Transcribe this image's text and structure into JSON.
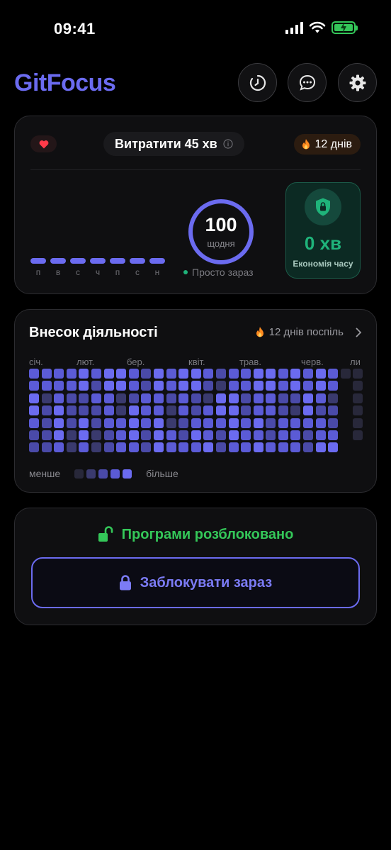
{
  "status_bar": {
    "time": "09:41"
  },
  "app": {
    "title": "GitFocus"
  },
  "summary": {
    "spend_label": "Витратити 45 хв",
    "streak_label": "12 днів",
    "weekdays": [
      "п",
      "в",
      "с",
      "ч",
      "п",
      "с",
      "н"
    ],
    "score": "100",
    "score_caption": "щодня",
    "status_now": "Просто зараз",
    "saving_value": "0 хв",
    "saving_caption": "Економія часу"
  },
  "activity": {
    "title": "Внесок діяльності",
    "streak_label": "12 днів поспіль",
    "months": [
      "січ.",
      "лют.",
      "бер.",
      "квіт.",
      "трав.",
      "черв.",
      "ли"
    ],
    "legend_less": "менше",
    "legend_more": "більше",
    "levels": [
      "#28283a",
      "#3a3a6e",
      "#4a4aa8",
      "#5b5bd6",
      "#6b6bf0"
    ]
  },
  "lock": {
    "status_text": "Програми розблоковано",
    "button_label": "Заблокувати зараз"
  },
  "colors": {
    "accent": "#6b6bf0",
    "success": "#34c759",
    "saving": "#1fb37a",
    "fire": "#ff8a1f"
  }
}
